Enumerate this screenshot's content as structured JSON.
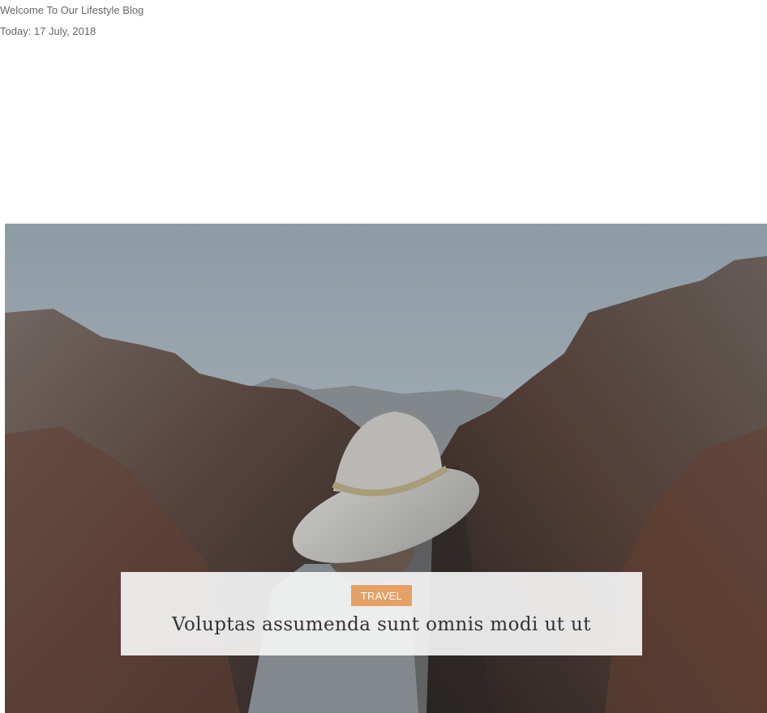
{
  "topbar": {
    "welcome_text": "Welcome To Our Lifestyle Blog",
    "today_text": "Today: 17 July, 2018"
  },
  "featured_post": {
    "image_alt": "Man in a white hat overlooking canyon",
    "category": "TRAVEL",
    "title": "Voluptas assumenda sunt omnis modi ut ut"
  },
  "colors": {
    "tag_background": "#e5a065",
    "caption_background": "#f5f5f5"
  }
}
